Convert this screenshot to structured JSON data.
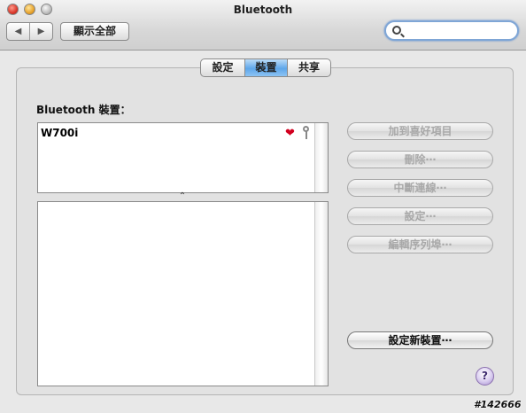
{
  "window": {
    "title": "Bluetooth",
    "nav_back": "◀",
    "nav_forward": "▶",
    "show_all_label": "顯示全部",
    "search": {
      "value": "",
      "placeholder": ""
    }
  },
  "tabs": [
    {
      "label": "設定",
      "selected": false
    },
    {
      "label": "裝置",
      "selected": true
    },
    {
      "label": "共享",
      "selected": false
    }
  ],
  "devices": {
    "list_label": "Bluetooth 裝置：",
    "items": [
      {
        "name": "W700i",
        "favorite_icon": "heart-icon",
        "paired_icon": "key-icon"
      }
    ],
    "divider_glyph": "⌃"
  },
  "actions": {
    "add_favorite": "加到喜好項目",
    "delete": "刪除⋯",
    "disconnect": "中斷連線⋯",
    "configure": "設定⋯",
    "edit_serial_ports": "編輯序列埠⋯",
    "setup_new_device": "設定新裝置⋯"
  },
  "help_label": "?",
  "watermark": "#142666",
  "colors": {
    "selected_tab": "#5ea6ea",
    "heart": "#d2001f"
  }
}
